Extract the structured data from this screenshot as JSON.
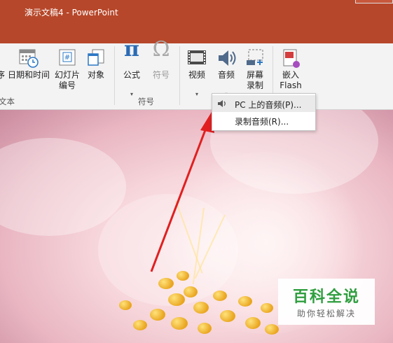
{
  "window": {
    "title": "演示文稿4 - PowerPoint"
  },
  "ribbon": {
    "groups": {
      "text": {
        "label": "文本"
      },
      "symbols": {
        "label": "符号"
      }
    },
    "buttons": {
      "text_box_partial": {
        "label": "序"
      },
      "date_time": {
        "label": "日期和时间"
      },
      "slide_number": {
        "label_line1": "幻灯片",
        "label_line2": "编号"
      },
      "object": {
        "label": "对象"
      },
      "equation": {
        "label": "公式",
        "glyph": "π"
      },
      "symbol": {
        "label": "符号",
        "glyph": "Ω"
      },
      "video": {
        "label": "视频"
      },
      "audio": {
        "label": "音频"
      },
      "screen_recording": {
        "label_line1": "屏幕",
        "label_line2": "录制"
      },
      "embed_flash": {
        "label_line1": "嵌入",
        "label_line2": "Flash"
      }
    },
    "caret": "▾"
  },
  "audio_menu": {
    "items": [
      {
        "label": "PC 上的音频(P)...",
        "icon": "speaker-icon"
      },
      {
        "label": "录制音频(R)..."
      }
    ]
  },
  "watermark": {
    "title": "百科全说",
    "subtitle": "助你轻松解决"
  },
  "colors": {
    "title_bar": "#b7472a",
    "arrow": "#e02020",
    "watermark_green": "#2f9e3f"
  }
}
